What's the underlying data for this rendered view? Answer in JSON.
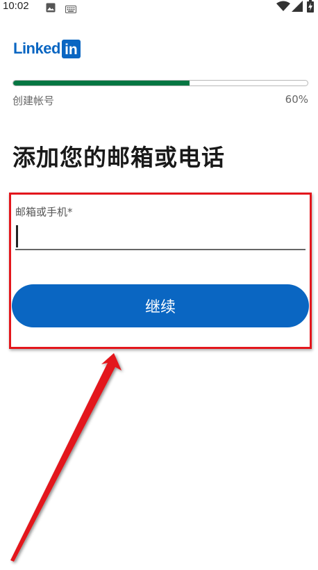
{
  "status_bar": {
    "time": "10:02",
    "icons": [
      "image-icon",
      "keyboard-icon",
      "wifi-icon",
      "signal-icon",
      "battery-icon"
    ]
  },
  "logo": {
    "text": "Linked",
    "box_text": "in",
    "brand_color": "#0a66c2"
  },
  "progress": {
    "label": "创建帐号",
    "percent_text": "60%",
    "value": 0.6,
    "fill_color": "#057642"
  },
  "title": "添加您的邮箱或电话",
  "form": {
    "field_label": "邮箱或手机*",
    "field_value": "",
    "continue_label": "继续"
  },
  "annotation": {
    "box_color": "#e3161c"
  }
}
